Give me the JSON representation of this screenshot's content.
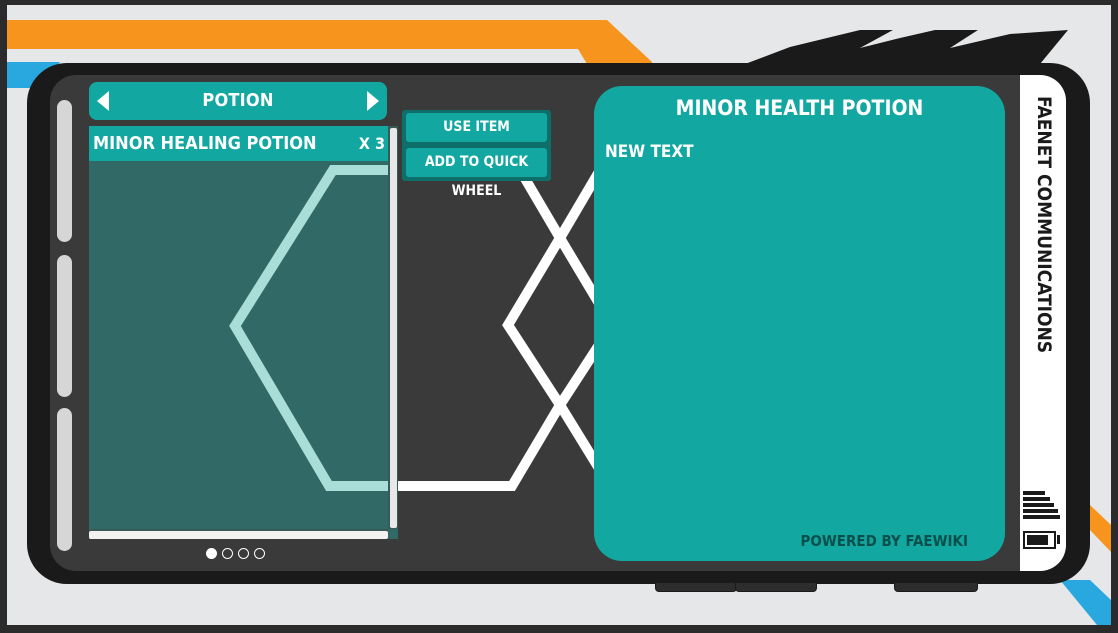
{
  "category": {
    "title": "POTION",
    "prev_icon": "triangle-left-icon",
    "next_icon": "triangle-right-icon"
  },
  "items": [
    {
      "name": "MINOR HEALING POTION",
      "quantity": "X 3"
    }
  ],
  "context_menu": {
    "use_item": "USE ITEM",
    "add_to_quick_wheel": "ADD TO QUICK WHEEL"
  },
  "detail": {
    "title": "MINOR HEALTH POTION",
    "description": "NEW TEXT",
    "footer": "POWERED BY FAEWIKI"
  },
  "sidebar": {
    "app_title": "FAENET COMMUNICATIONS",
    "signal_icon": "signal-bars-icon",
    "battery_icon": "battery-icon",
    "battery_level": 0.85
  },
  "pagination": {
    "total_pages": 4,
    "current_page": 1
  },
  "colors": {
    "accent": "#12a7a0",
    "list_background": "#2f6b67",
    "screen": "#3a3a3b",
    "orange_stripe": "#f7941d",
    "blue_stripe": "#29a8e0"
  }
}
